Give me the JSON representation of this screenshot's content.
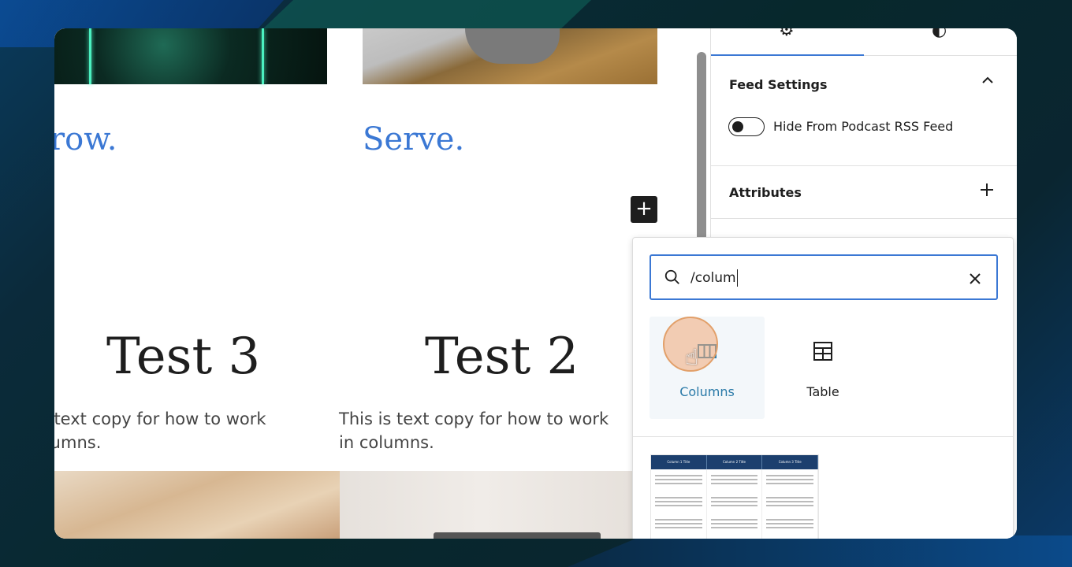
{
  "canvas": {
    "heading_left": "row.",
    "heading_right": "Serve.",
    "plus_label": "+",
    "title_left": "Test 3",
    "title_right": "Test 2",
    "copy_left": "is text copy for how to work\nolumns.",
    "copy_right": "This is text copy for how to work in columns."
  },
  "sidebar": {
    "tabs": [
      {
        "icon": "gear-icon",
        "glyph": "⚙"
      },
      {
        "icon": "contrast-icon",
        "glyph": "◐"
      }
    ],
    "feed_settings": {
      "title": "Feed Settings",
      "toggle_label": "Hide From Podcast RSS Feed",
      "toggle_on": false
    },
    "attributes": {
      "title": "Attributes"
    }
  },
  "inserter": {
    "search_value": "/colum",
    "blocks": [
      {
        "label": "Columns",
        "icon": "columns-icon"
      },
      {
        "label": "Table",
        "icon": "table-icon"
      }
    ],
    "pattern_headers": [
      "Column 1 Title",
      "Column 2 Title",
      "Column 3 Title"
    ]
  },
  "colors": {
    "accent": "#3b78d4",
    "heading_blue": "#3b78d4",
    "dark": "#1e1e1e"
  }
}
